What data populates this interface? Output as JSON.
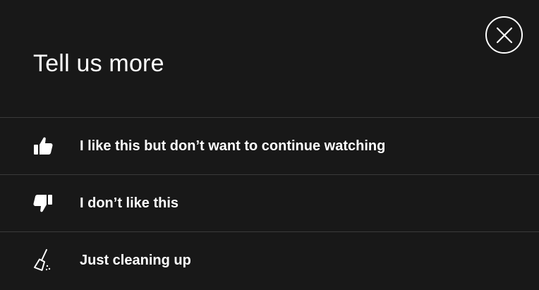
{
  "dialog": {
    "title": "Tell us more",
    "close_icon": "close-icon"
  },
  "options": [
    {
      "label": "I like this but don’t want to continue watching",
      "icon": "thumbs-up-icon"
    },
    {
      "label": "I don’t like this",
      "icon": "thumbs-down-icon"
    },
    {
      "label": "Just cleaning up",
      "icon": "broom-icon"
    }
  ],
  "colors": {
    "background": "#181818",
    "text": "#ffffff",
    "divider": "#3a3a3a"
  }
}
